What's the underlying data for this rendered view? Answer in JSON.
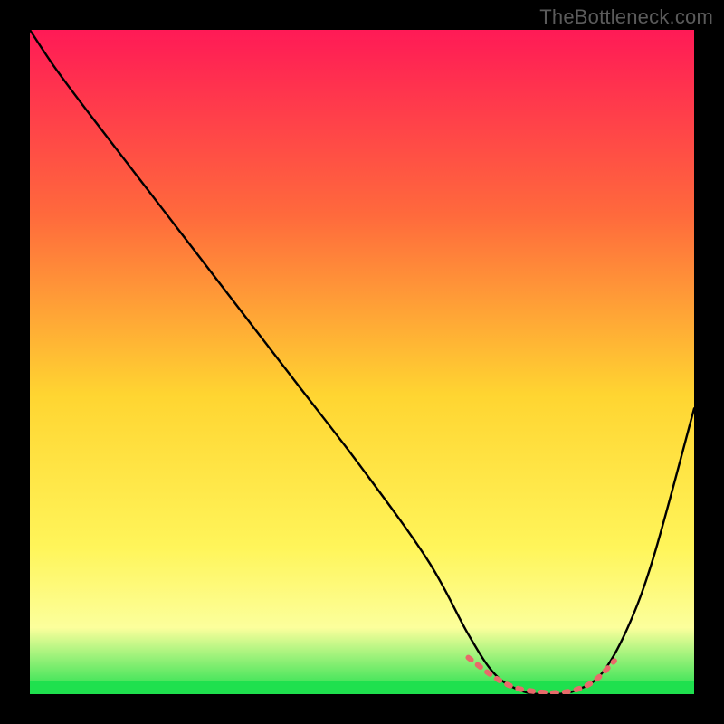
{
  "watermark": "TheBottleneck.com",
  "colors": {
    "gradient_top": "#ff1a56",
    "gradient_mid_upper": "#ff6a3c",
    "gradient_mid": "#ffd531",
    "gradient_mid_lower": "#fff55a",
    "gradient_lower": "#fcff9c",
    "gradient_bottom": "#1fe04e",
    "curve": "#000000",
    "highlight": "#e86a6a",
    "frame": "#000000"
  },
  "chart_data": {
    "type": "line",
    "title": "",
    "xlabel": "",
    "ylabel": "",
    "xlim": [
      0,
      100
    ],
    "ylim": [
      0,
      100
    ],
    "annotations": [],
    "series": [
      {
        "name": "bottleneck-curve",
        "x": [
          0,
          4,
          10,
          20,
          30,
          40,
          50,
          60,
          66,
          70,
          74,
          78,
          82,
          86,
          90,
          94,
          100
        ],
        "y": [
          100,
          94,
          86,
          73,
          60,
          47,
          34,
          20,
          9,
          3,
          0.5,
          0,
          0.5,
          3,
          10,
          21,
          43
        ]
      }
    ],
    "highlight_region": {
      "name": "optimal-band",
      "points_x": [
        66,
        70,
        73,
        76,
        79,
        82,
        85,
        88
      ],
      "points_y": [
        5.5,
        2.5,
        1.0,
        0.4,
        0.2,
        0.6,
        2.0,
        5.0
      ]
    }
  }
}
